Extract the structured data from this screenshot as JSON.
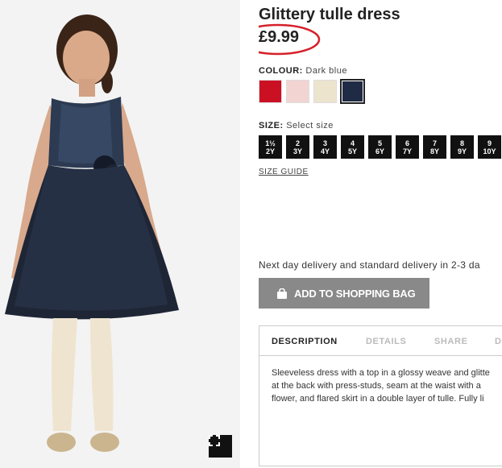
{
  "product": {
    "title": "Glittery tulle dress",
    "price": "£9.99"
  },
  "colour": {
    "label": "COLOUR:",
    "selected": "Dark blue",
    "swatches": [
      {
        "name": "Red",
        "hex": "#cc1024"
      },
      {
        "name": "Light pink",
        "hex": "#f2d4d2"
      },
      {
        "name": "Cream",
        "hex": "#ede4ce"
      },
      {
        "name": "Dark blue",
        "hex": "#1f2a44"
      }
    ]
  },
  "size": {
    "label": "SIZE:",
    "prompt": "Select size",
    "options": [
      {
        "top": "1½",
        "bottom": "2Y"
      },
      {
        "top": "2",
        "bottom": "3Y"
      },
      {
        "top": "3",
        "bottom": "4Y"
      },
      {
        "top": "4",
        "bottom": "5Y"
      },
      {
        "top": "5",
        "bottom": "6Y"
      },
      {
        "top": "6",
        "bottom": "7Y"
      },
      {
        "top": "7",
        "bottom": "8Y"
      },
      {
        "top": "8",
        "bottom": "9Y"
      },
      {
        "top": "9",
        "bottom": "10Y"
      }
    ],
    "guide_label": "SIZE GUIDE"
  },
  "delivery_text": "Next day delivery and standard delivery in 2-3 da",
  "add_to_bag_label": "ADD TO SHOPPING BAG",
  "tabs": [
    "DESCRIPTION",
    "DETAILS",
    "SHARE",
    "D"
  ],
  "description_lines": [
    "Sleeveless dress with a top in a glossy weave and glitte",
    "at the back with press-studs, seam at the waist with a",
    "flower, and flared skirt in a double layer of tulle. Fully li"
  ],
  "icons": {
    "fullscreen": "fullscreen-icon",
    "bag": "shopping-bag-icon"
  },
  "colors": {
    "annotation": "#d6202a",
    "button_grey": "#898989",
    "size_bg": "#111111"
  }
}
